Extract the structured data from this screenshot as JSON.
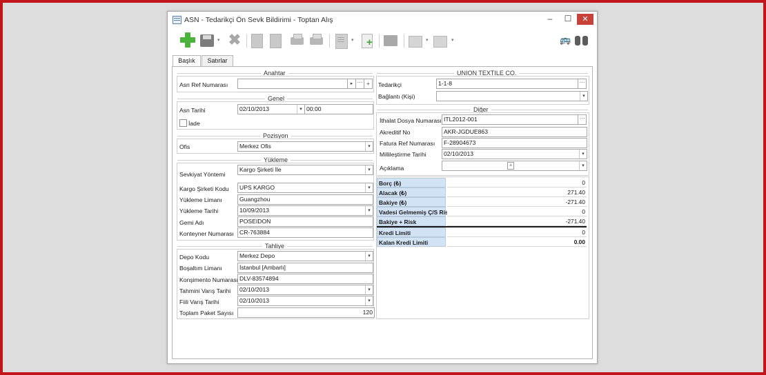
{
  "window": {
    "title": "ASN - Tedarikçi Ön Sevk Bildirimi - Toptan Alış",
    "min_glyph": "▭",
    "max_glyph": "▫",
    "close_glyph": "✕"
  },
  "toolbar": {
    "icons": [
      "add-icon",
      "save-icon",
      "delete-icon",
      "document-icon",
      "edit-document-icon",
      "print-preview-icon",
      "print-icon",
      "page-icon",
      "add-page-icon",
      "archive-icon",
      "report-icon",
      "chart-icon",
      "vehicle-icon",
      "binoculars-icon"
    ],
    "dropdown_glyph": "▾",
    "delete_glyph": "✖",
    "bus_glyph": "🚌"
  },
  "tabs": [
    {
      "label": "Başlık",
      "active": true
    },
    {
      "label": "Satırlar",
      "active": false
    }
  ],
  "left": {
    "anahtar": {
      "title": "Anahtar",
      "asn_ref_label": "Asn Ref Numarası",
      "asn_ref_value": "",
      "btn_next": "▸",
      "btn_dots": "···",
      "btn_plus": "+"
    },
    "genel": {
      "title": "Genel",
      "asn_tarihi_label": "Asn Tarihi",
      "asn_tarihi_value": "02/10/2013",
      "asn_saat_value": "00:00",
      "iade_label": "İade",
      "iade_checked": false
    },
    "pozisyon": {
      "title": "Pozisyon",
      "ofis_label": "Ofis",
      "ofis_value": "Merkez Ofis"
    },
    "yukleme": {
      "title": "Yükleme",
      "sevkiyat_label": "Sevkiyat Yöntemi",
      "sevkiyat_value": "Kargo Şirketi İle",
      "kargo_label": "Kargo Şirketi Kodu",
      "kargo_value": "UPS KARGO",
      "liman_label": "Yükleme Limanı",
      "liman_value": "Guangzhou",
      "tarih_label": "Yükleme Tarihi",
      "tarih_value": "10/09/2013",
      "gemi_label": "Gemi Adı",
      "gemi_value": "POSEIDON",
      "konteyner_label": "Konteyner Numarası",
      "konteyner_value": "CR-763884"
    },
    "tahliye": {
      "title": "Tahliye",
      "depo_label": "Depo Kodu",
      "depo_value": "Merkez Depo",
      "bosaltim_label": "Boşaltım Limanı",
      "bosaltim_value": "İstanbul [Ambarlı]",
      "konsimento_label": "Konşimento Numarası",
      "konsimento_value": "DLV-83574894",
      "tahmini_label": "Tahmini Varış Tarihi",
      "tahmini_value": "02/10/2013",
      "fiili_label": "Fiili Varış Tarihi",
      "fiili_value": "02/10/2013",
      "paket_label": "Toplam Paket Sayısı",
      "paket_value": "120"
    }
  },
  "right": {
    "supplier": {
      "title": "UNION TEXTILE CO.",
      "tedarikci_label": "Tedarikçi",
      "tedarikci_value": "1-1-8",
      "baglanti_label": "Bağlantı (Kişi)",
      "baglanti_value": ""
    },
    "diger": {
      "title": "Diğer",
      "ithalat_label": "İthalat Dosya Numarası",
      "ithalat_value": "ITL2012-001",
      "akreditif_label": "Akreditif No",
      "akreditif_value": "AKR-JGDUE863",
      "fatura_label": "Fatura Ref Numarası",
      "fatura_value": "F-28904673",
      "millilestirme_label": "Millileştirme Tarihi",
      "millilestirme_value": "02/10/2013",
      "aciklama_label": "Açıklama",
      "aciklama_value": ""
    },
    "financials": [
      {
        "label": "Borç (₺)",
        "value": "0"
      },
      {
        "label": "Alacak (₺)",
        "value": "271.40"
      },
      {
        "label": "Bakiye (₺)",
        "value": "-271.40"
      },
      {
        "label": "Vadesi Gelmemiş Ç/S Riski",
        "value": "0"
      },
      {
        "label": "Bakiye + Risk",
        "value": "-271.40"
      },
      {
        "label": "Kredi Limiti",
        "value": "0"
      },
      {
        "label": "Kalan Kredi Limiti",
        "value": "0.00"
      }
    ]
  },
  "glyphs": {
    "combo": "▾",
    "dots": "···"
  }
}
